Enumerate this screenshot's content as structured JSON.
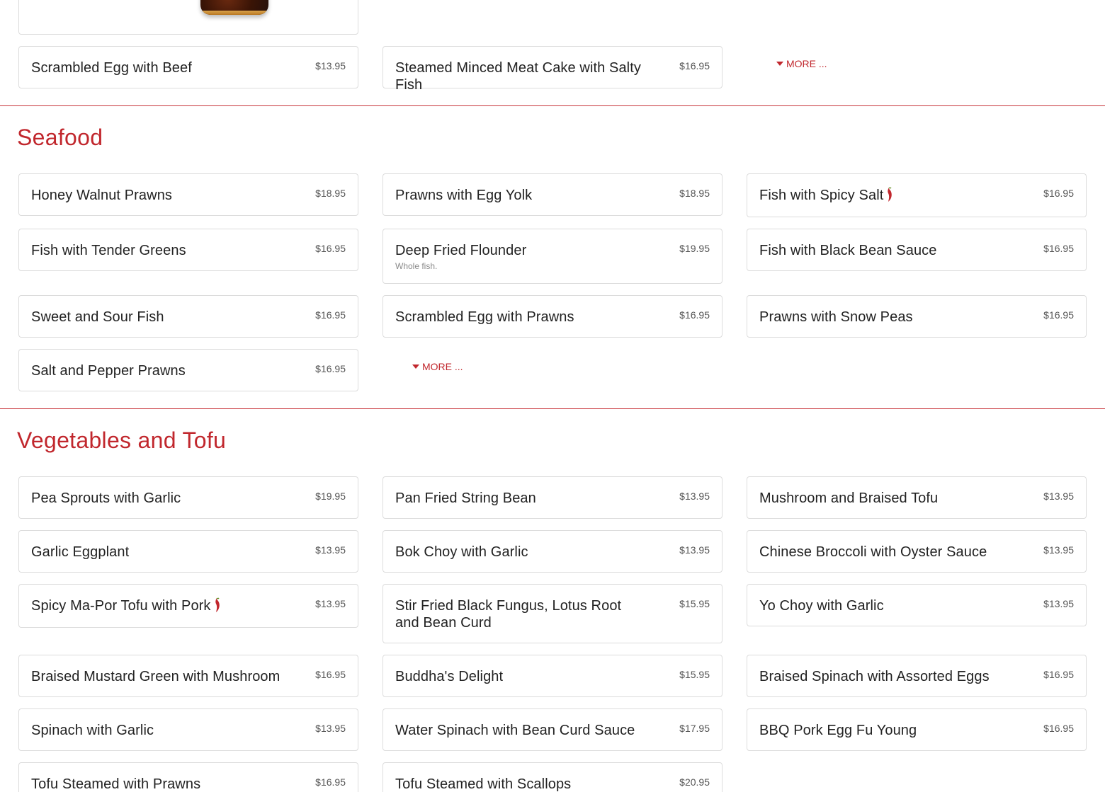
{
  "top_section": {
    "items": [
      {
        "name": "Scrambled Egg with Beef",
        "price": "$13.95"
      },
      {
        "name": "Steamed Minced Meat Cake with Salty Fish",
        "price": "$16.95"
      }
    ],
    "more_label": "MORE ..."
  },
  "seafood": {
    "title": "Seafood",
    "items": [
      {
        "name": "Honey Walnut Prawns",
        "price": "$18.95"
      },
      {
        "name": "Prawns with Egg Yolk",
        "price": "$18.95"
      },
      {
        "name": "Fish with Spicy Salt",
        "price": "$16.95",
        "spicy": true
      },
      {
        "name": "Fish with Tender Greens",
        "price": "$16.95"
      },
      {
        "name": "Deep Fried Flounder",
        "price": "$19.95",
        "description": "Whole fish."
      },
      {
        "name": "Fish with Black Bean Sauce",
        "price": "$16.95"
      },
      {
        "name": "Sweet and Sour Fish",
        "price": "$16.95"
      },
      {
        "name": "Scrambled Egg with Prawns",
        "price": "$16.95"
      },
      {
        "name": "Prawns with Snow Peas",
        "price": "$16.95"
      },
      {
        "name": "Salt and Pepper Prawns",
        "price": "$16.95"
      }
    ],
    "more_label": "MORE ..."
  },
  "vegetables": {
    "title": "Vegetables and Tofu",
    "items": [
      {
        "name": "Pea Sprouts with Garlic",
        "price": "$19.95"
      },
      {
        "name": "Pan Fried String Bean",
        "price": "$13.95"
      },
      {
        "name": "Mushroom and Braised Tofu",
        "price": "$13.95"
      },
      {
        "name": "Garlic Eggplant",
        "price": "$13.95"
      },
      {
        "name": "Bok Choy with Garlic",
        "price": "$13.95"
      },
      {
        "name": "Chinese Broccoli with Oyster Sauce",
        "price": "$13.95"
      },
      {
        "name": "Spicy Ma-Por Tofu with Pork",
        "price": "$13.95",
        "spicy": true
      },
      {
        "name": "Stir Fried Black Fungus, Lotus Root and Bean Curd",
        "price": "$15.95"
      },
      {
        "name": "Yo Choy with Garlic",
        "price": "$13.95"
      },
      {
        "name": "Braised Mustard Green with Mushroom",
        "price": "$16.95"
      },
      {
        "name": "Buddha's Delight",
        "price": "$15.95"
      },
      {
        "name": "Braised Spinach with Assorted Eggs",
        "price": "$16.95"
      },
      {
        "name": "Spinach with Garlic",
        "price": "$13.95"
      },
      {
        "name": "Water Spinach with Bean Curd Sauce",
        "price": "$17.95"
      },
      {
        "name": "BBQ Pork Egg Fu Young",
        "price": "$16.95"
      },
      {
        "name": "Tofu Steamed with Prawns",
        "price": "$16.95"
      },
      {
        "name": "Tofu Steamed with Scallops",
        "price": "$20.95"
      }
    ]
  },
  "colors": {
    "accent": "#c1272d",
    "card_border": "#dcdcdc"
  },
  "icons": {
    "spicy": "chili-pepper-icon",
    "more": "caret-down-icon"
  }
}
